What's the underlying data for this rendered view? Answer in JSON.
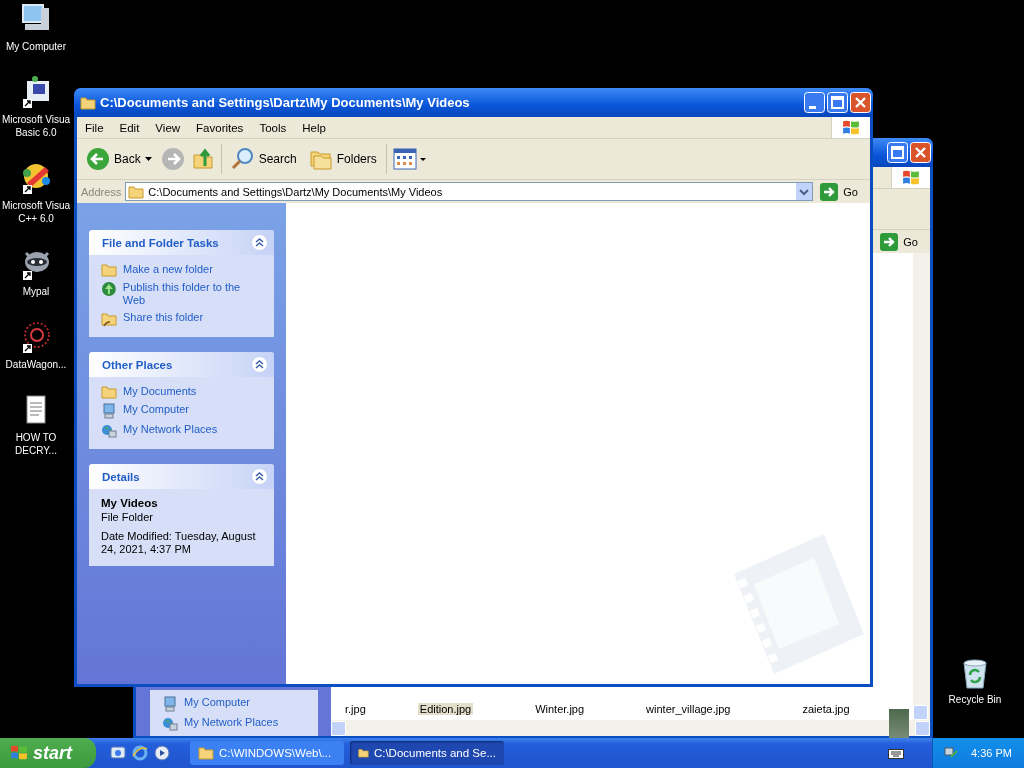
{
  "desktop_icons": [
    {
      "label": "My Computer",
      "kind": "computer"
    },
    {
      "label": "Microsoft Visua Basic 6.0",
      "kind": "vb"
    },
    {
      "label": "Microsoft Visua C++ 6.0",
      "kind": "vcpp"
    },
    {
      "label": "Mypal",
      "kind": "mypal"
    },
    {
      "label": "DataWagon...",
      "kind": "datawagon"
    },
    {
      "label": "HOW TO DECRY...",
      "kind": "document"
    }
  ],
  "recycle_bin": {
    "label": "Recycle Bin"
  },
  "back_window": {
    "go": "Go",
    "places": [
      "My Computer",
      "My Network Places"
    ],
    "files": [
      {
        "label": "r.jpg",
        "selected": false
      },
      {
        "label": "Edition.jpg",
        "selected": true
      },
      {
        "label": "Winter.jpg",
        "selected": false
      },
      {
        "label": "winter_village.jpg",
        "selected": false
      },
      {
        "label": "zaieta.jpg",
        "selected": false
      }
    ]
  },
  "window": {
    "title": "C:\\Documents and Settings\\Dartz\\My Documents\\My Videos",
    "menu": [
      "File",
      "Edit",
      "View",
      "Favorites",
      "Tools",
      "Help"
    ],
    "toolbar": {
      "back": "Back",
      "search": "Search",
      "folders": "Folders"
    },
    "address": {
      "label": "Address",
      "value": "C:\\Documents and Settings\\Dartz\\My Documents\\My Videos",
      "go": "Go"
    },
    "panels": [
      {
        "kind": "links",
        "title": "File and Folder Tasks",
        "items": [
          {
            "label": "Make a new folder",
            "kind": "new-folder"
          },
          {
            "label": "Publish this folder to the Web",
            "kind": "publish"
          },
          {
            "label": "Share this folder",
            "kind": "share"
          }
        ]
      },
      {
        "kind": "links",
        "title": "Other Places",
        "items": [
          {
            "label": "My Documents",
            "kind": "folder"
          },
          {
            "label": "My Computer",
            "kind": "computer"
          },
          {
            "label": "My Network Places",
            "kind": "network"
          }
        ]
      },
      {
        "kind": "details",
        "title": "Details",
        "name": "My Videos",
        "type": "File Folder",
        "modified": "Date Modified: Tuesday, August 24, 2021, 4:37 PM"
      }
    ]
  },
  "taskbar": {
    "start": "start",
    "tasks": [
      {
        "label": "C:\\WINDOWS\\Web\\...",
        "selected": false
      },
      {
        "label": "C:\\Documents and Se...",
        "selected": true
      }
    ],
    "clock": "4:36 PM"
  }
}
